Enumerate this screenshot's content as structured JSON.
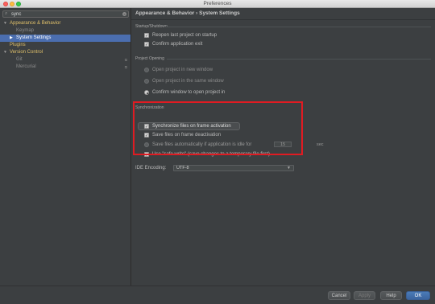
{
  "window": {
    "title": "Preferences"
  },
  "search": {
    "value": "sync"
  },
  "tree": [
    {
      "label_hl": "Appearance & Behavior",
      "label_rest": "",
      "expanded": true,
      "selected": false
    },
    {
      "label_hl": "",
      "label_rest": "Keymap",
      "selected": false,
      "dim": true
    },
    {
      "label_hl": "System Settings",
      "label_rest": "",
      "selected": true
    },
    {
      "label_hl": "Plugins",
      "label_rest": "",
      "selected": false
    },
    {
      "label_hl": "Version Control",
      "label_rest": "",
      "expanded": true,
      "selected": false
    },
    {
      "label_hl": "",
      "label_rest": "Git",
      "selected": false,
      "dim": true
    },
    {
      "label_hl": "",
      "label_rest": "Mercurial",
      "selected": false,
      "dim": true
    }
  ],
  "main": {
    "breadcrumb": "Appearance & Behavior › System Settings",
    "startup": {
      "title": "Startup/Shutdown",
      "reopen": "Reopen last project on startup",
      "confirm_exit": "Confirm application exit"
    },
    "project_opening": {
      "title": "Project Opening",
      "new_window": "Open project in new window",
      "same_window": "Open project in the same window",
      "confirm_window": "Confirm window to open project in"
    },
    "sync": {
      "title": "Synchronization",
      "sync_on_activation": "Synchronize files on frame activation",
      "save_on_deactivation": "Save files on frame deactivation",
      "save_auto": "Save files automatically if application is idle for",
      "idle_seconds": "15",
      "unit": "sec",
      "safe_write": "Use \"safe write\" (save changes to a temporary file first)"
    },
    "encoding": {
      "label": "IDE Encoding:",
      "value": "UTF-8"
    }
  },
  "buttons": {
    "cancel": "Cancel",
    "apply": "Apply",
    "help": "Help",
    "ok": "OK"
  },
  "colors": {
    "accent": "#4b6eaf",
    "highlight": "#e01b22",
    "primary_button": "#4b7bb7"
  }
}
